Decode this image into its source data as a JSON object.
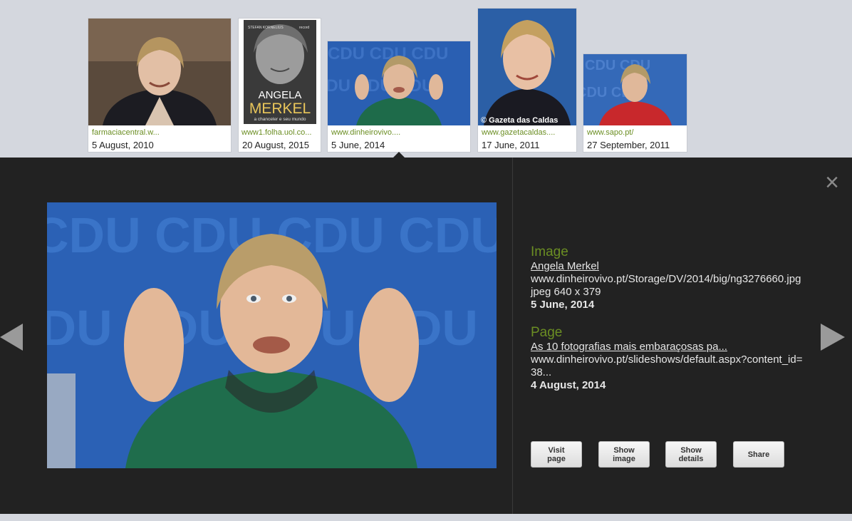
{
  "thumbnails": [
    {
      "site": "farmaciacentral.w...",
      "date": "5 August, 2010"
    },
    {
      "site": "www1.folha.uol.co...",
      "date": "20 August, 2015",
      "cover_title_1": "ANGELA",
      "cover_title_2": "MERKEL",
      "cover_subtitle": "a chanceler e seu mundo",
      "cover_author": "STEFAN KORNELIUS",
      "cover_publisher": "record"
    },
    {
      "site": "www.dinheirovivo....",
      "date": "5 June, 2014"
    },
    {
      "site": "www.gazetacaldas....",
      "date": "17 June, 2011",
      "watermark": "© Gazeta das Caldas"
    },
    {
      "site": "www.sapo.pt/",
      "date": "27 September, 2011"
    }
  ],
  "viewer": {
    "close_label": "×",
    "image_section": {
      "heading": "Image",
      "title": "Angela Merkel",
      "url": "www.dinheirovivo.pt/Storage/DV/2014/big/ng3276660.jpg",
      "meta": "jpeg 640 x 379",
      "date": "5 June, 2014"
    },
    "page_section": {
      "heading": "Page",
      "title": "As 10 fotografias mais embaraçosas pa...",
      "url": "www.dinheirovivo.pt/slideshows/default.aspx?content_id=38...",
      "date": "4 August, 2014"
    },
    "buttons": {
      "visit_page": "Visit page",
      "show_image": "Show image",
      "show_details": "Show details",
      "share": "Share"
    }
  },
  "colors": {
    "strip_background": "#d4d7de",
    "viewer_background": "#222222",
    "accent_green": "#6b8e23"
  }
}
